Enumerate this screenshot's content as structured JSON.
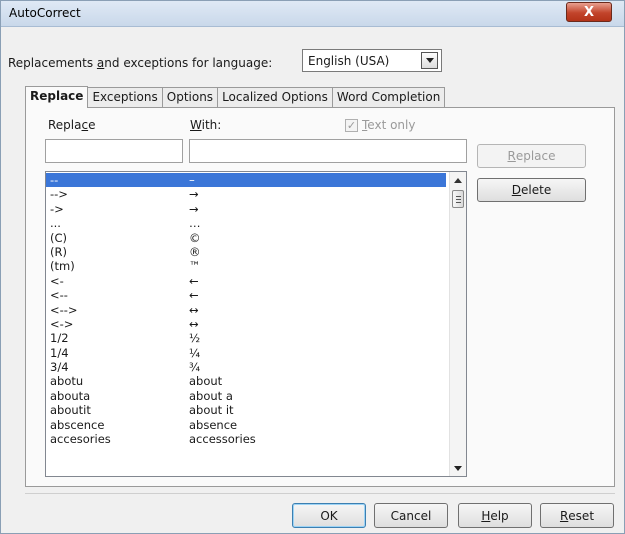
{
  "window": {
    "title": "AutoCorrect",
    "close_label": "X"
  },
  "language": {
    "label_pre": "Replacements ",
    "label_key": "a",
    "label_post": "nd exceptions for language:",
    "value": "English (USA)"
  },
  "tabs": [
    {
      "label": "Replace",
      "active": true
    },
    {
      "label": "Exceptions"
    },
    {
      "label": "Options"
    },
    {
      "label": "Localized Options"
    },
    {
      "label": "Word Completion"
    }
  ],
  "replace_label": {
    "pre": "Repla",
    "key": "c",
    "post": "e"
  },
  "with_label": {
    "key": "W",
    "post": "ith:"
  },
  "text_only": {
    "key": "T",
    "post": "ext only",
    "checked": true
  },
  "replace_input": {
    "value": ""
  },
  "with_input": {
    "value": ""
  },
  "buttons": {
    "replace": {
      "key": "R",
      "post": "eplace"
    },
    "delete": {
      "key": "D",
      "post": "elete"
    },
    "ok": "OK",
    "cancel": "Cancel",
    "help": {
      "key": "H",
      "post": "elp"
    },
    "reset": {
      "key": "R",
      "post": "eset"
    }
  },
  "entries": [
    {
      "from": "--",
      "to": "–",
      "selected": true
    },
    {
      "from": "-->",
      "to": "→"
    },
    {
      "from": "->",
      "to": "→"
    },
    {
      "from": "...",
      "to": "…"
    },
    {
      "from": "(C)",
      "to": "©"
    },
    {
      "from": "(R)",
      "to": "®"
    },
    {
      "from": "(tm)",
      "to": "™"
    },
    {
      "from": "<-",
      "to": "←"
    },
    {
      "from": "<--",
      "to": "←"
    },
    {
      "from": "<-->",
      "to": "↔"
    },
    {
      "from": "<->",
      "to": "↔"
    },
    {
      "from": "1/2",
      "to": "½"
    },
    {
      "from": "1/4",
      "to": "¼"
    },
    {
      "from": "3/4",
      "to": "¾"
    },
    {
      "from": "abotu",
      "to": "about"
    },
    {
      "from": "abouta",
      "to": "about a"
    },
    {
      "from": "aboutit",
      "to": "about it"
    },
    {
      "from": "abscence",
      "to": "absence"
    },
    {
      "from": "accesories",
      "to": "accessories"
    }
  ],
  "icons": {
    "dropdown": "chevron-down-icon",
    "scroll_up": "arrow-up-icon",
    "scroll_down": "arrow-down-icon",
    "checkmark": "checkmark-icon"
  },
  "colors": {
    "selection": "#3b76d8",
    "close_button": "#c2442b",
    "default_button_border": "#3c7fb1"
  }
}
